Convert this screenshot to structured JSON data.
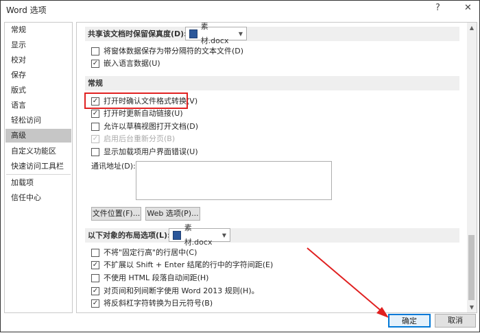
{
  "window": {
    "title": "Word 选项",
    "help": "?",
    "close": "✕"
  },
  "sidebar": {
    "items": [
      "常规",
      "显示",
      "校对",
      "保存",
      "版式",
      "语言",
      "轻松访问",
      "高级",
      "自定义功能区",
      "快速访问工具栏",
      "加载项",
      "信任中心"
    ],
    "selected": "高级"
  },
  "share": {
    "label": "共享该文档时保留保真度(D):",
    "doc": "素材.docx",
    "options": [
      {
        "label": "将窗体数据保存为带分隔符的文本文件(D)",
        "checked": false
      },
      {
        "label": "嵌入语言数据(U)",
        "checked": true
      }
    ]
  },
  "general": {
    "header": "常规",
    "options": [
      {
        "label": "打开时确认文件格式转换(V)",
        "checked": true
      },
      {
        "label": "打开时更新自动链接(U)",
        "checked": true
      },
      {
        "label": "允许以草稿视图打开文档(D)",
        "checked": false
      },
      {
        "label": "启用后台重新分页(B)",
        "checked": true,
        "disabled": true
      },
      {
        "label": "显示加载项用户界面错误(U)",
        "checked": false
      }
    ],
    "address_label": "通讯地址(D):",
    "address_value": "",
    "file_locations": "文件位置(F)...",
    "web_options": "Web 选项(P)..."
  },
  "layout": {
    "label": "以下对象的布局选项(L):",
    "doc": "素材.docx",
    "options": [
      {
        "label": "不将\"固定行高\"的行居中(C)",
        "checked": false
      },
      {
        "label": "不扩展以 Shift + Enter 结尾的行中的字符间距(E)",
        "checked": true
      },
      {
        "label": "不使用 HTML 段落自动间距(H)",
        "checked": false
      },
      {
        "label": "对页间和列间断字使用 Word 2013 规则(H)。",
        "checked": true
      },
      {
        "label": "将反斜杠字符转换为日元符号(B)",
        "checked": true
      }
    ]
  },
  "footer": {
    "ok": "确定",
    "cancel": "取消"
  },
  "colors": {
    "annotation": "#e02020",
    "selected": "#c6c6c6"
  }
}
